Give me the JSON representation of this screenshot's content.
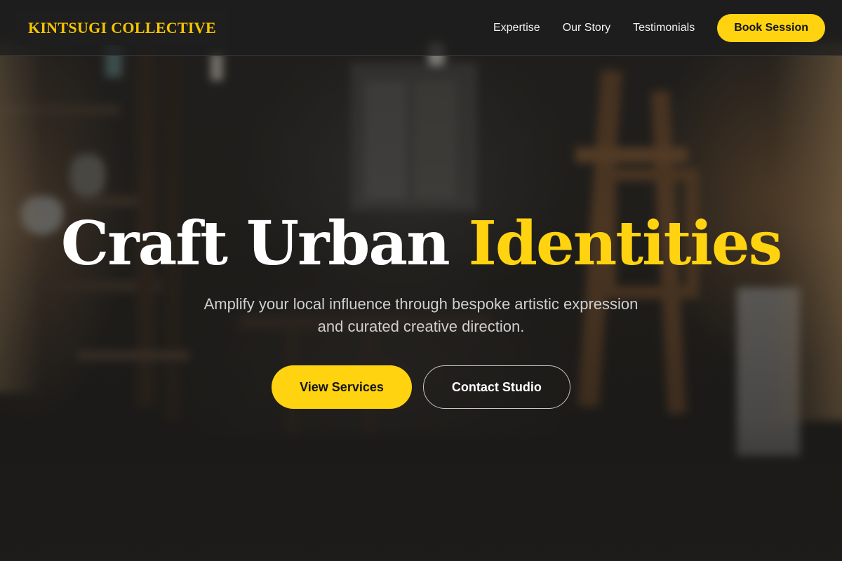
{
  "brand": {
    "name": "KINTSUGI COLLECTIVE",
    "accent_color": "#ffd30f"
  },
  "nav": {
    "links": [
      {
        "label": "Expertise"
      },
      {
        "label": "Our Story"
      },
      {
        "label": "Testimonials"
      }
    ],
    "cta_label": "Book Session"
  },
  "hero": {
    "title_main": "Craft Urban",
    "title_accent": "Identities",
    "subtitle": "Amplify your local influence through bespoke artistic expression and curated creative direction.",
    "primary_button": "View Services",
    "secondary_button": "Contact Studio",
    "background": "blurred-workshop-photo"
  }
}
